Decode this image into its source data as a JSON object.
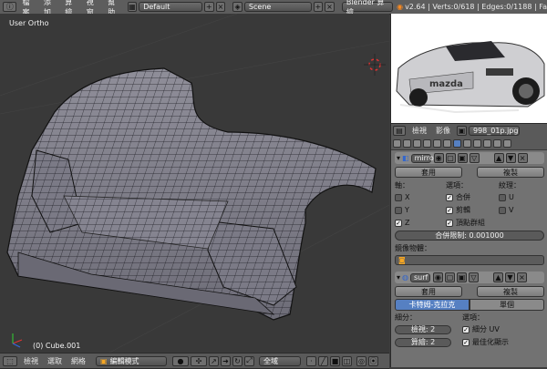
{
  "topbar": {
    "menus": [
      "檔案",
      "添加",
      "算繪",
      "視窗",
      "幫助"
    ],
    "layout": "Default",
    "scene": "Scene",
    "engine": "Blender 算繪",
    "stats": "v2.64 | Verts:0/618 | Edges:0/1188 | Fa"
  },
  "viewport": {
    "title": "User Ortho",
    "object": "(0) Cube.001"
  },
  "bottombar": {
    "menus": [
      "檢視",
      "選取",
      "網格"
    ],
    "mode": "編輯模式",
    "pivot": "全域"
  },
  "imageeditor": {
    "menus": [
      "檢視",
      "影像"
    ],
    "filename": "998_01p.jpg"
  },
  "props": {
    "mod1": {
      "name": "mirror",
      "apply": "套用",
      "copy": "複製",
      "axis_label": "軸：",
      "options_label": "選項：",
      "texture_label": "紋理：",
      "axes": [
        {
          "label": "X",
          "checked": false
        },
        {
          "label": "Y",
          "checked": false
        },
        {
          "label": "Z",
          "checked": true
        }
      ],
      "options": [
        {
          "label": "合併",
          "checked": true
        },
        {
          "label": "剪輯",
          "checked": true
        },
        {
          "label": "頂點群組",
          "checked": true
        }
      ],
      "textures": [
        {
          "label": "U",
          "checked": false
        },
        {
          "label": "V",
          "checked": false
        }
      ],
      "merge_limit": "合併限制: 0.001000",
      "mirror_object_label": "鏡像物體："
    },
    "mod2": {
      "name": "surf",
      "apply": "套用",
      "copy": "複製",
      "tab_active": "卡特姆-克拉克",
      "tab_other": "單個",
      "subdiv_label": "細分：",
      "options_label": "選項：",
      "view_level": "檢視: 2",
      "render_level": "算繪: 2",
      "opts": [
        {
          "label": "細分 UV",
          "checked": true
        },
        {
          "label": "最佳化顯示",
          "checked": true
        }
      ]
    }
  }
}
